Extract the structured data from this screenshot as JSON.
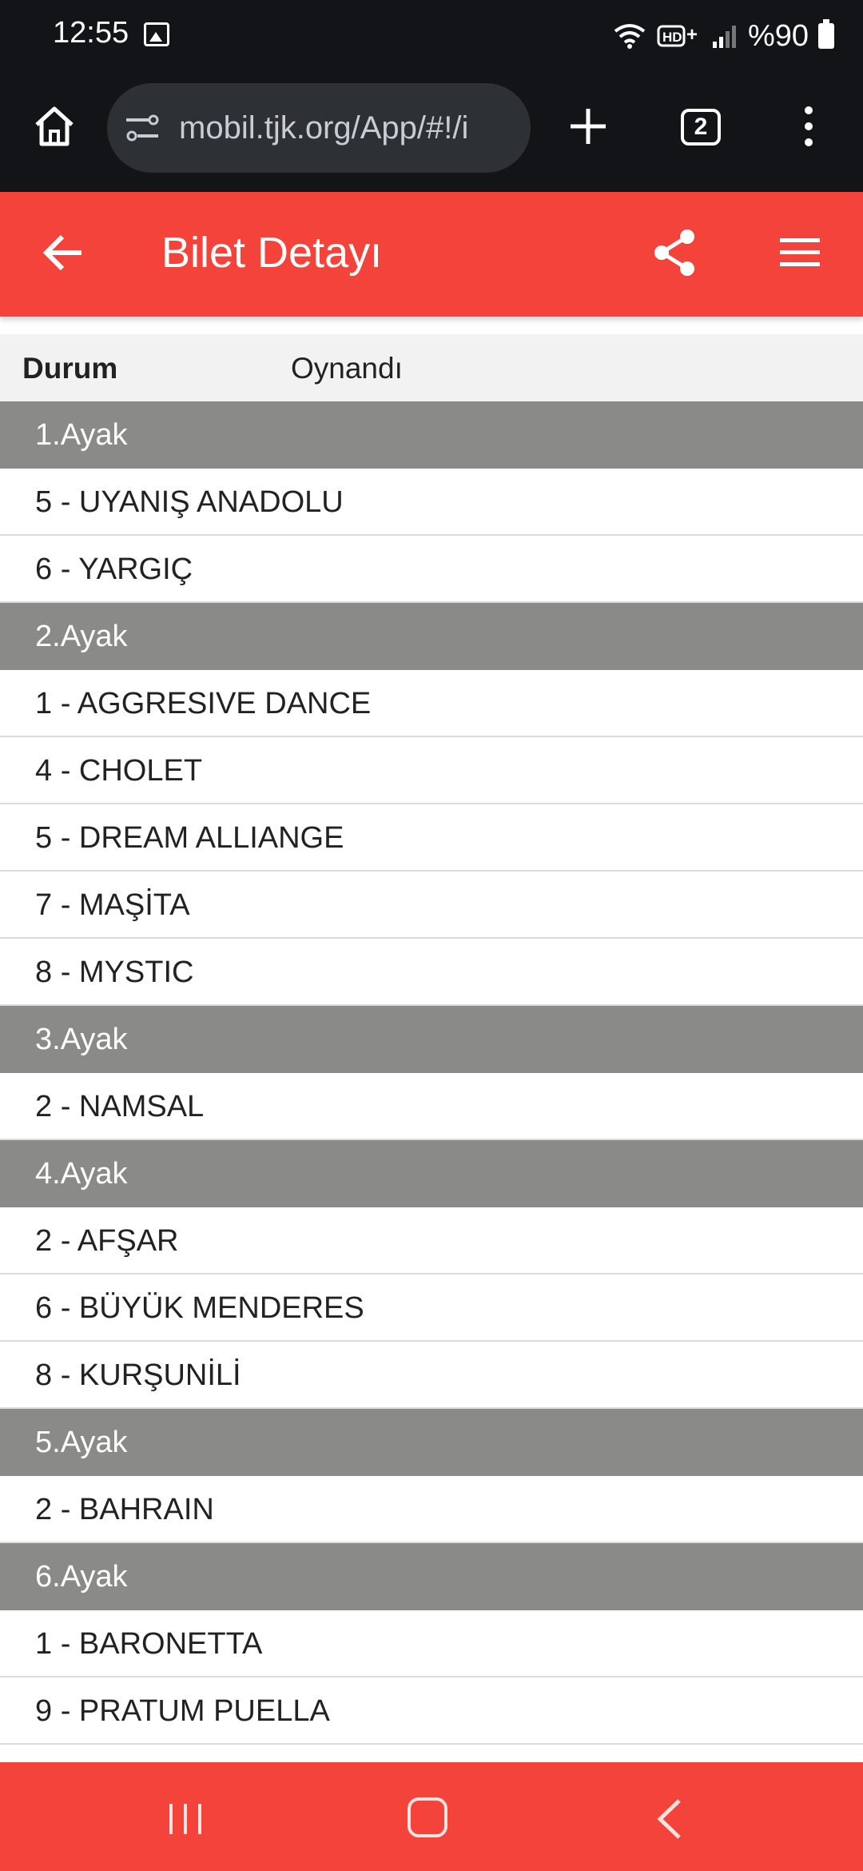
{
  "status_bar": {
    "time": "12:55",
    "battery_text": "%90",
    "icons": [
      "image-icon",
      "wifi-icon",
      "hd-plus-icon",
      "signal-icon",
      "battery-icon"
    ]
  },
  "browser": {
    "url": "mobil.tjk.org/App/#!/i",
    "tab_count": "2",
    "icons": [
      "home-icon",
      "tune-icon",
      "plus-icon",
      "tabs-icon",
      "more-vert-icon"
    ]
  },
  "header": {
    "title": "Bilet Detayı",
    "icons": [
      "arrow-back-icon",
      "share-icon",
      "menu-icon"
    ],
    "color": "#f4433a"
  },
  "ticket": {
    "status_label": "Durum",
    "status_value": "Oynandı",
    "legs": [
      {
        "label": "1.Ayak",
        "horses": [
          "5 - UYANIŞ ANADOLU",
          "6 - YARGIÇ"
        ]
      },
      {
        "label": "2.Ayak",
        "horses": [
          "1 - AGGRESIVE DANCE",
          "4 - CHOLET",
          "5 - DREAM ALLIANGE",
          "7 - MAŞİTA",
          "8 - MYSTIC"
        ]
      },
      {
        "label": "3.Ayak",
        "horses": [
          "2 - NAMSAL"
        ]
      },
      {
        "label": "4.Ayak",
        "horses": [
          "2 - AFŞAR",
          "6 - BÜYÜK MENDERES",
          "8 - KURŞUNİLİ"
        ]
      },
      {
        "label": "5.Ayak",
        "horses": [
          "2 - BAHRAIN"
        ]
      },
      {
        "label": "6.Ayak",
        "horses": [
          "1 - BARONETTA",
          "9 - PRATUM PUELLA"
        ]
      }
    ]
  },
  "nav": {
    "icons": [
      "recents-icon",
      "home-circle-icon",
      "back-chevron-icon"
    ]
  },
  "colors": {
    "accent": "#f4433a",
    "leg_header": "#8a8a89",
    "status_bg": "#f2f2f2",
    "chrome_bg": "#131417"
  }
}
